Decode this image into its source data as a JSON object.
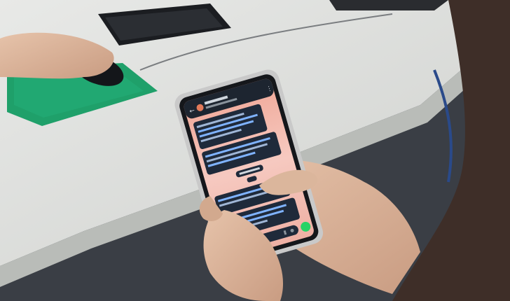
{
  "photo": {
    "chat": {
      "contact_name": "",
      "contact_status": "",
      "date_chip": "",
      "input_placeholder": ""
    },
    "colors": {
      "desk": "#d9dbd8",
      "floor_shadow": "#2a2d33",
      "mouse_pad": "#1fa06a",
      "phone_case": "#c9c9c9",
      "chat_background": "#f2b9ad",
      "bubble": "#1f2a3a",
      "bubble_text": "#7fb3ff",
      "send_button": "#25d366",
      "skin": "#d8b39a"
    },
    "icons": [
      "back-arrow-icon",
      "avatar",
      "menu-dots-icon",
      "emoji-icon",
      "attach-icon",
      "camera-icon",
      "send-icon"
    ]
  }
}
